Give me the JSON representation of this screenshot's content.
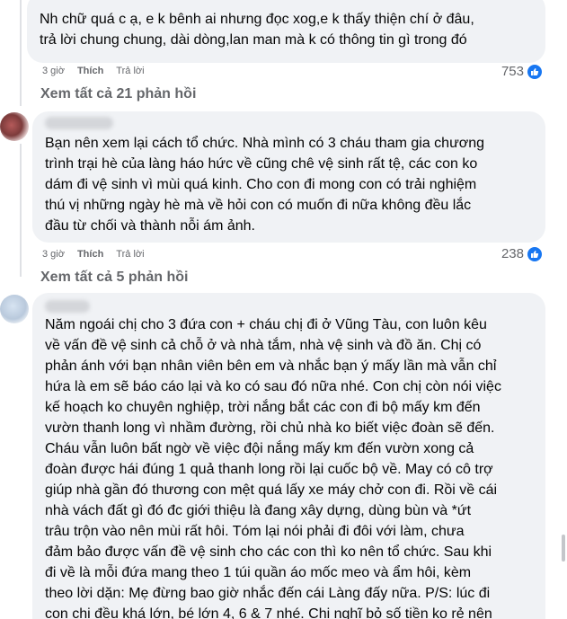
{
  "comments": [
    {
      "text": "Nh chữ quá c ạ, e k bênh ai nhưng đọc xog,e k thấy thiện chí ở đâu,\ntrả lời chung chung, dài dòng,lan man mà k có thông tin gì trong đó",
      "time": "3 giờ",
      "like_label": "Thích",
      "reply_label": "Trả lời",
      "likes": "753",
      "see_all": "Xem tất cả 21 phản hồi"
    },
    {
      "text": "Bạn nên xem lại cách tổ chức. Nhà mình có 3 cháu tham gia chương\ntrình trại hè của làng háo hức về cũng chê vệ sinh rất tệ, các con ko\ndám đi vệ sinh vì mùi quá kinh. Cho con đi mong con có trải nghiệm\nthú vị những ngày hè mà về hỏi con có muốn đi nữa không đều lắc\nđầu từ chối và thành nỗi ám ảnh.",
      "time": "3 giờ",
      "like_label": "Thích",
      "reply_label": "Trả lời",
      "likes": "238",
      "see_all": "Xem tất cả 5 phản hồi"
    },
    {
      "text": "Năm ngoái chị cho 3 đứa con + cháu chị đi ở Vũng Tàu, con luôn kêu\nvề vấn đề vệ sinh cả chỗ ở và nhà tắm, nhà vệ sinh và đồ ăn. Chị có\nphản ánh với bạn nhân viên bên em và nhắc bạn ý mấy lần mà vẫn chỉ\nhứa là em sẽ báo cáo lại và ko có sau đó nữa nhé. Con chị còn nói việc\nkế hoạch ko chuyên nghiệp, trời nắng bắt các con đi bộ mấy km đến\nvườn thanh long vì nhầm đường, rồi chủ nhà ko biết việc đoàn sẽ đến.\nCháu vẫn luôn bất ngờ về việc đội nắng mấy km đến vườn xong cả\nđoàn được hái đúng 1 quả thanh long rồi lại cuốc bộ về. May có cô trợ\ngiúp nhà gần đó thương con mệt quá lấy xe máy chở con đi. Rồi về cái\nnhà vách đất gì đó đc giới thiệu là đang xây dựng, dùng bùn và *ứt\ntrâu trộn vào nên mùi rất hôi. Tóm lại nói phải đi đôi với làm, chưa\nđảm bảo được vấn đề vệ sinh cho các con thì ko nên tổ chức. Sau khi\nđi về là mỗi đứa mang theo 1 túi quần áo mốc meo và ẩm hôi, kèm\ntheo lời dặn: Mẹ đừng bao giờ nhắc đến cái Làng đấy nữa. P/S: lúc đi\ncon chị đều khá lớn, bé lớn 4, 6 & 7 nhé. Chị nghĩ bỏ số tiền ko rẻ nên"
    }
  ]
}
